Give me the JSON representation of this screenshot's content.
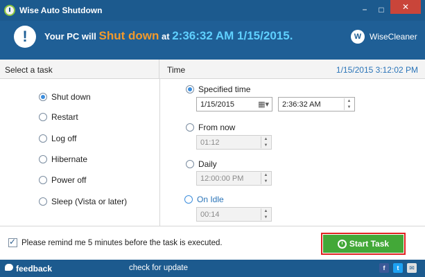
{
  "window": {
    "title": "Wise Auto Shutdown",
    "controls": {
      "minimize": "−",
      "maximize": "□",
      "close": "✕"
    }
  },
  "banner": {
    "prefix": "Your PC will",
    "action": "Shut down",
    "middle": "at",
    "time": "2:36:32 AM 1/15/2015",
    "suffix": ".",
    "brand_icon_letter": "W",
    "brand": "WiseCleaner"
  },
  "task_section": {
    "header": "Select a task",
    "options": [
      {
        "label": "Shut down",
        "checked": true
      },
      {
        "label": "Restart",
        "checked": false
      },
      {
        "label": "Log off",
        "checked": false
      },
      {
        "label": "Hibernate",
        "checked": false
      },
      {
        "label": "Power off",
        "checked": false
      },
      {
        "label": "Sleep (Vista or later)",
        "checked": false
      }
    ]
  },
  "time_section": {
    "header": "Time",
    "current_datetime": "1/15/2015 3:12:02 PM",
    "specified": {
      "label": "Specified time",
      "date": "1/15/2015",
      "time": "2:36:32 AM"
    },
    "from_now": {
      "label": "From now",
      "value": "01:12"
    },
    "daily": {
      "label": "Daily",
      "value": "12:00:00 PM"
    },
    "on_idle": {
      "label": "On Idle",
      "value": "00:14"
    }
  },
  "footer": {
    "remind_text": "Please remind me 5 minutes before the task is executed.",
    "start_button": "Start Task"
  },
  "statusbar": {
    "feedback": "feedback",
    "update": "check for update",
    "icons": {
      "facebook": "f",
      "twitter": "t",
      "email": "✉"
    }
  },
  "colors": {
    "titlebar": "#1c5a8e",
    "banner": "#1f5f96",
    "action": "#f39a2b",
    "time": "#5fd0ff",
    "start_button": "#43a838",
    "highlight_border": "#e02020",
    "link_blue": "#2a74b8"
  }
}
